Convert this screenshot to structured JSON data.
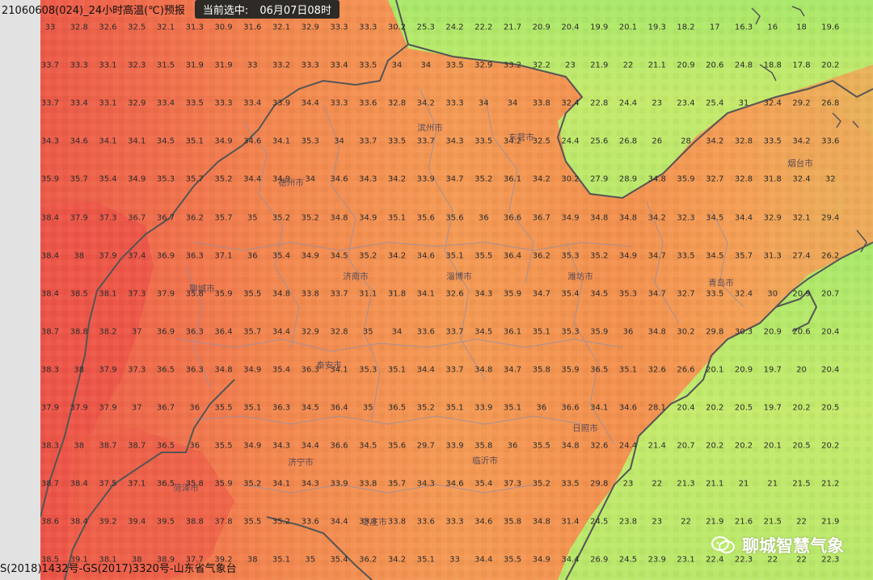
{
  "header": {
    "title": "21060608(024)_24小时高温(℃)预报",
    "selected_label": "当前选中:",
    "selected_time": "06月07日08时"
  },
  "footer": {
    "text": "S(2018)1432号-GS(2017)3320号-山东省气象台"
  },
  "watermark": {
    "text": "聊城智慧气象",
    "icon": "wechat-icon"
  },
  "colors": {
    "hot": "#ef5a48",
    "warm": "#f3874e",
    "mild": "#f6a556",
    "cool": "#cdea6a",
    "cold": "#9fe866",
    "border": "#555555",
    "county": "#9a8fa0"
  },
  "cities": [
    "滨州市",
    "东营市",
    "德州市",
    "烟台市",
    "济南市",
    "淄博市",
    "潍坊市",
    "青岛市",
    "聊城市",
    "泰安市",
    "日照市",
    "济宁市",
    "临沂市",
    "菏泽市",
    "枣庄市"
  ],
  "grid": {
    "rows": [
      [
        "33",
        "32.8",
        "32.6",
        "32.5",
        "32.1",
        "31.3",
        "30.9",
        "31.6",
        "32.1",
        "32.9",
        "33.3",
        "33.3",
        "30.2",
        "25.3",
        "24.2",
        "22.2",
        "21.7",
        "20.9",
        "20.4",
        "19.9",
        "20.1",
        "19.3",
        "18.2",
        "17",
        "16.3",
        "16",
        "18",
        "19.6"
      ],
      [
        "33.7",
        "33.3",
        "33.1",
        "32.3",
        "31.5",
        "31.9",
        "31.9",
        "33",
        "33.2",
        "33.3",
        "33.4",
        "33.5",
        "34",
        "34",
        "33.5",
        "32.9",
        "33.2",
        "32.2",
        "23",
        "21.9",
        "22",
        "21.1",
        "20.9",
        "20.6",
        "24.8",
        "18.8",
        "17.8",
        "20.2"
      ],
      [
        "33.7",
        "33.4",
        "33.1",
        "32.9",
        "33.4",
        "33.5",
        "33.3",
        "33.4",
        "33.9",
        "34.4",
        "33.3",
        "33.6",
        "32.8",
        "34.2",
        "33.3",
        "34",
        "34",
        "33.8",
        "32.4",
        "22.8",
        "24.4",
        "23",
        "23.4",
        "25.4",
        "31",
        "32.4",
        "29.2",
        "26.8"
      ],
      [
        "34.3",
        "34.6",
        "34.1",
        "34.1",
        "34.5",
        "35.1",
        "34.9",
        "34.6",
        "34.1",
        "35.3",
        "34",
        "33.7",
        "33.5",
        "33.7",
        "34.3",
        "33.5",
        "34.2",
        "32.5",
        "24.4",
        "25.6",
        "26.8",
        "26",
        "28",
        "34.2",
        "32.8",
        "33.5",
        "34.2",
        "33.6"
      ],
      [
        "35.9",
        "35.7",
        "35.4",
        "34.9",
        "35.3",
        "35.7",
        "35.2",
        "34.4",
        "34.9",
        "34",
        "34.6",
        "34.3",
        "34.2",
        "33.9",
        "34.7",
        "35.2",
        "36.1",
        "34.2",
        "30.2",
        "27.9",
        "28.9",
        "34.8",
        "35.9",
        "32.7",
        "32.8",
        "31.8",
        "32.4",
        "32"
      ],
      [
        "38.4",
        "37.9",
        "37.3",
        "36.7",
        "36.7",
        "36.2",
        "35.7",
        "35",
        "35.2",
        "35.2",
        "34.8",
        "34.9",
        "35.1",
        "35.6",
        "35.6",
        "36",
        "36.6",
        "36.7",
        "34.9",
        "34.8",
        "34.8",
        "34.2",
        "32.3",
        "34.5",
        "34.4",
        "32.9",
        "32.1",
        "29.4"
      ],
      [
        "38.4",
        "38",
        "37.9",
        "37.4",
        "36.9",
        "36.3",
        "37.1",
        "36",
        "35.4",
        "34.9",
        "34.5",
        "35.2",
        "34.2",
        "34.6",
        "35.1",
        "35.5",
        "36.4",
        "36.2",
        "35.3",
        "35.2",
        "34.9",
        "34.7",
        "33.5",
        "34.5",
        "35.7",
        "31.3",
        "27.4",
        "26.2"
      ],
      [
        "38.4",
        "38.5",
        "38.1",
        "37.3",
        "37.9",
        "35.8",
        "35.9",
        "35.5",
        "34.8",
        "33.8",
        "33.7",
        "31.1",
        "31.8",
        "34.1",
        "32.6",
        "34.3",
        "35.9",
        "34.7",
        "35.4",
        "34.5",
        "35.3",
        "34.7",
        "32.7",
        "33.5",
        "32.4",
        "30",
        "20.9",
        "20.7"
      ],
      [
        "38.7",
        "38.8",
        "38.2",
        "37",
        "36.9",
        "36.3",
        "36.4",
        "35.7",
        "34.4",
        "32.9",
        "32.8",
        "35",
        "34",
        "33.6",
        "33.7",
        "34.5",
        "36.1",
        "35.1",
        "35.3",
        "35.9",
        "36",
        "34.8",
        "30.2",
        "29.8",
        "30.3",
        "20.9",
        "20.6",
        "20.4"
      ],
      [
        "38.3",
        "38",
        "37.9",
        "37.3",
        "36.5",
        "36.3",
        "34.8",
        "34.9",
        "35.4",
        "36.3",
        "34.1",
        "35.3",
        "35.1",
        "34.4",
        "33.7",
        "34.8",
        "34.7",
        "35.8",
        "35.9",
        "36.5",
        "35.1",
        "32.6",
        "26.6",
        "20.1",
        "20.9",
        "19.7",
        "20",
        "20.4"
      ],
      [
        "37.9",
        "37.9",
        "37.9",
        "37",
        "36.7",
        "36",
        "35.5",
        "35.1",
        "36.3",
        "34.5",
        "36.4",
        "35",
        "36.5",
        "35.2",
        "35.1",
        "33.9",
        "35.1",
        "36",
        "36.6",
        "34.1",
        "34.6",
        "28.1",
        "20.4",
        "20.2",
        "20.5",
        "19.7",
        "20.2",
        "20.5"
      ],
      [
        "38.3",
        "38",
        "38.7",
        "38.7",
        "36.5",
        "36",
        "35.5",
        "34.9",
        "34.3",
        "34.4",
        "36.6",
        "34.5",
        "35.6",
        "29.7",
        "33.9",
        "35.8",
        "36",
        "35.5",
        "34.8",
        "32.6",
        "24.4",
        "21.4",
        "20.7",
        "20.2",
        "20.2",
        "20.1",
        "20.5",
        "20.2"
      ],
      [
        "38.7",
        "38.4",
        "37.5",
        "37.1",
        "36.5",
        "35.8",
        "35.9",
        "35.2",
        "34.1",
        "34.3",
        "33.9",
        "33.8",
        "35.7",
        "34.3",
        "34.6",
        "35.4",
        "37.3",
        "35.2",
        "33.5",
        "29.8",
        "23",
        "22",
        "21.3",
        "21.1",
        "21",
        "21",
        "21.5",
        "21.2"
      ],
      [
        "38.6",
        "38.4",
        "39.2",
        "39.4",
        "39.5",
        "38.8",
        "37.8",
        "35.5",
        "35.2",
        "33.6",
        "34.4",
        "33.8",
        "33.8",
        "33.6",
        "33.3",
        "34.6",
        "35.8",
        "34.8",
        "31.4",
        "24.5",
        "23.8",
        "23",
        "22",
        "21.9",
        "21.6",
        "21.5",
        "22",
        "21.9"
      ],
      [
        "38.5",
        "39.1",
        "38.1",
        "38",
        "38.9",
        "37.7",
        "39.2",
        "38",
        "35.1",
        "35",
        "35.4",
        "36.2",
        "34.2",
        "35.1",
        "33",
        "34.4",
        "35.5",
        "34.9",
        "34.4",
        "26.9",
        "24.5",
        "23.9",
        "23.1",
        "22.4",
        "22.3",
        "22",
        "22",
        "22.3"
      ]
    ]
  }
}
